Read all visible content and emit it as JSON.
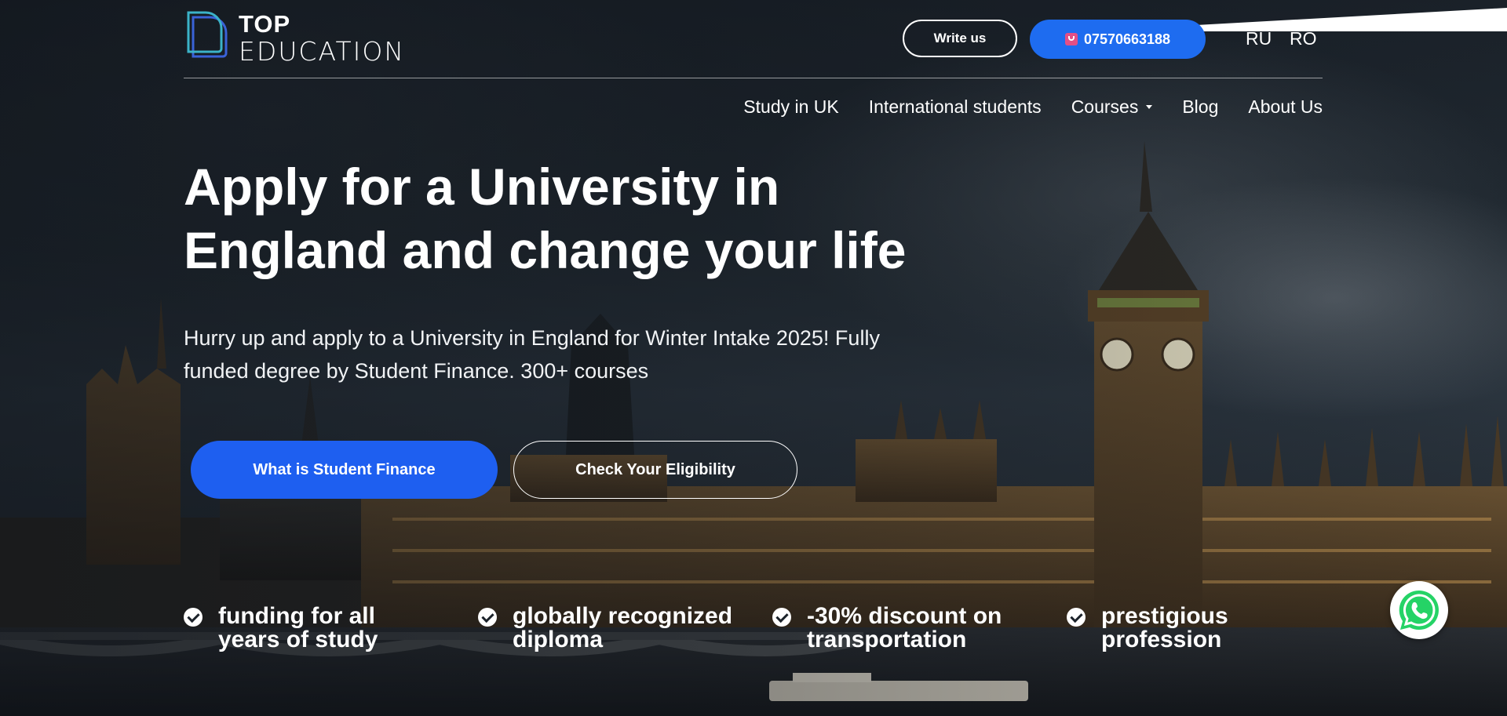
{
  "brand": {
    "name_top": "TOP",
    "name_bottom": "EDUCATION",
    "accent": "#1e6cf0",
    "logo_colors": [
      "#3bb3c8",
      "#3a62d8"
    ]
  },
  "header": {
    "write_us_label": "Write us",
    "phone_label": "07570663188",
    "phone_icon": "phone-icon",
    "languages": [
      "RU",
      "RO"
    ]
  },
  "nav": {
    "items": [
      {
        "label": "Study in UK"
      },
      {
        "label": "International students"
      },
      {
        "label": "Courses",
        "has_dropdown": true
      },
      {
        "label": "Blog"
      },
      {
        "label": "About Us"
      }
    ]
  },
  "hero": {
    "title_line1": "Apply for a University in",
    "title_line2": "England and change your life",
    "subtitle_line1": "Hurry up and apply to a University in England for Winter Intake 2025! Fully",
    "subtitle_line2": "funded degree by Student Finance. 300+ courses",
    "primary_button": "What is Student Finance",
    "secondary_button": "Check Your Eligibility"
  },
  "features": [
    {
      "line1": "funding for all",
      "line2": "years of study"
    },
    {
      "line1": "globally recognized",
      "line2": "diploma"
    },
    {
      "line1": "-30% discount on",
      "line2": "transportation"
    },
    {
      "line1": "prestigious",
      "line2": "profession"
    }
  ],
  "whatsapp": {
    "icon": "whatsapp-icon",
    "color": "#25d366"
  }
}
